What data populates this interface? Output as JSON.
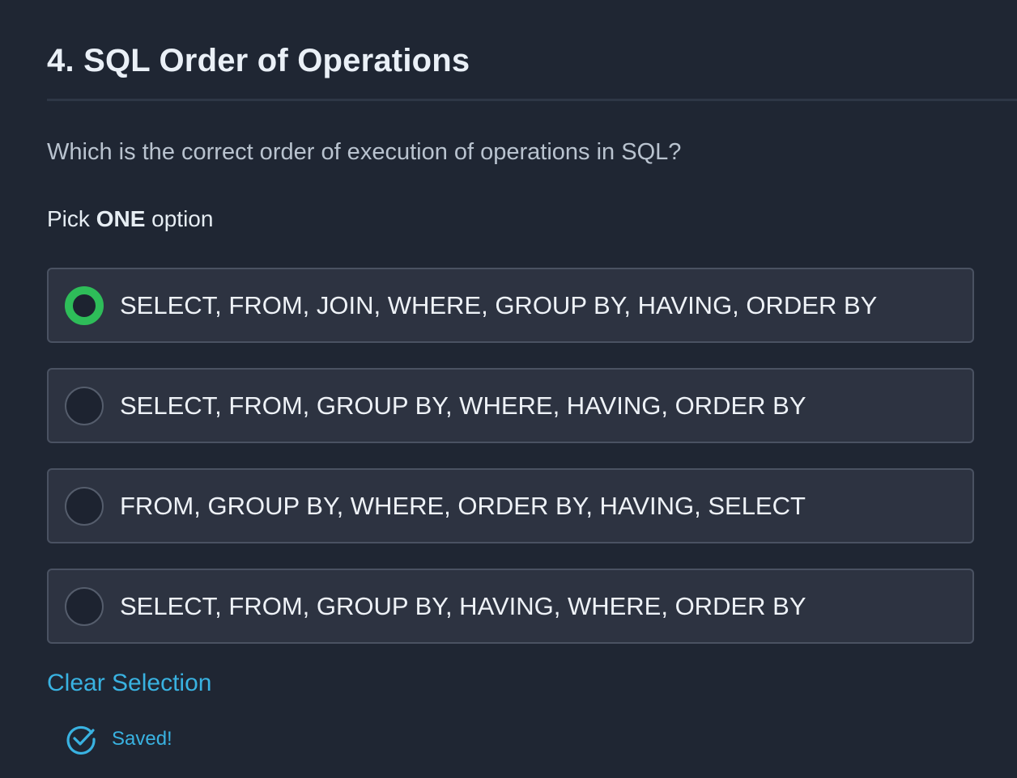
{
  "question": {
    "title": "4. SQL Order of Operations",
    "prompt": "Which is the correct order of execution of operations in SQL?",
    "instruction_prefix": "Pick ",
    "instruction_emphasis": "ONE",
    "instruction_suffix": " option",
    "options": [
      {
        "label": "SELECT, FROM, JOIN, WHERE, GROUP BY, HAVING, ORDER BY",
        "selected": true
      },
      {
        "label": "SELECT, FROM, GROUP BY, WHERE, HAVING, ORDER BY",
        "selected": false
      },
      {
        "label": "FROM, GROUP BY, WHERE, ORDER BY, HAVING, SELECT",
        "selected": false
      },
      {
        "label": "SELECT, FROM, GROUP BY, HAVING, WHERE, ORDER BY",
        "selected": false
      }
    ],
    "clear_label": "Clear Selection",
    "saved_label": "Saved!",
    "saved_icon": "check-circle-icon"
  },
  "colors": {
    "background": "#1f2633",
    "option_background": "#2d3341",
    "selected_radio": "#2ebd59",
    "link": "#39b2e1"
  }
}
